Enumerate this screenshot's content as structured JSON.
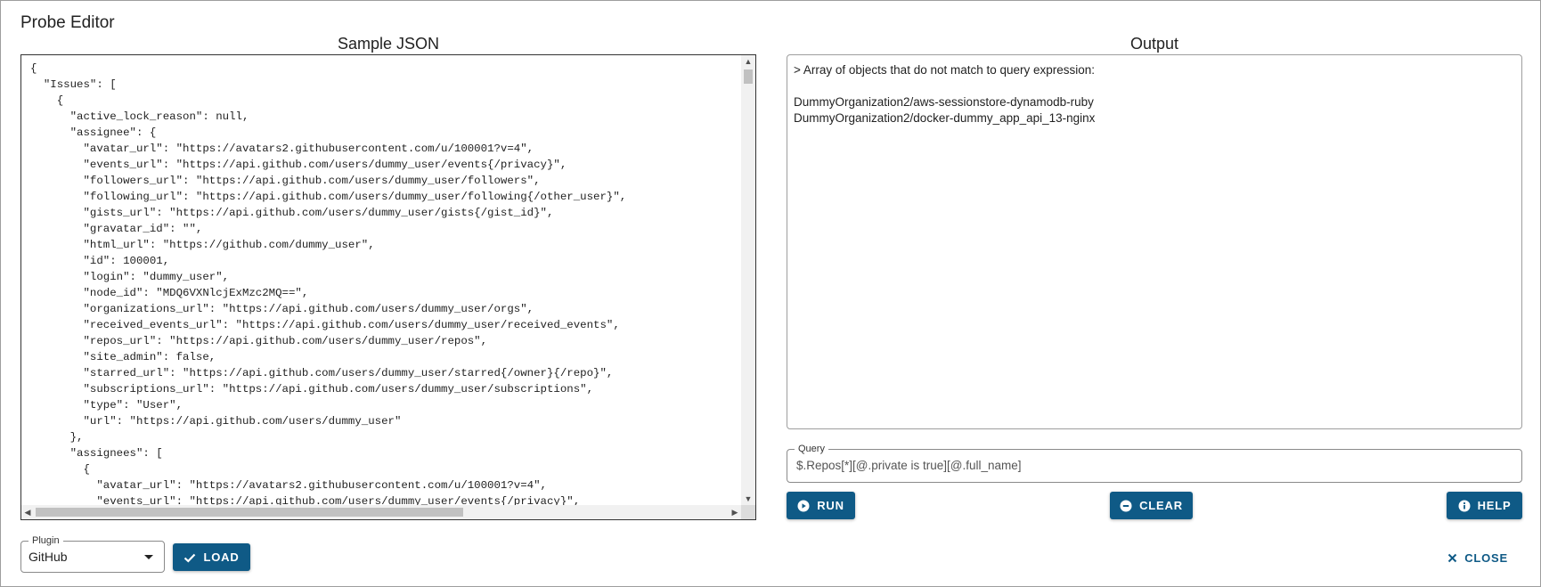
{
  "dialog": {
    "title": "Probe Editor"
  },
  "sample_json": {
    "heading": "Sample JSON",
    "lines": [
      "{",
      "  \"Issues\": [",
      "    {",
      "      \"active_lock_reason\": null,",
      "      \"assignee\": {",
      "        \"avatar_url\": \"https://avatars2.githubusercontent.com/u/100001?v=4\",",
      "        \"events_url\": \"https://api.github.com/users/dummy_user/events{/privacy}\",",
      "        \"followers_url\": \"https://api.github.com/users/dummy_user/followers\",",
      "        \"following_url\": \"https://api.github.com/users/dummy_user/following{/other_user}\",",
      "        \"gists_url\": \"https://api.github.com/users/dummy_user/gists{/gist_id}\",",
      "        \"gravatar_id\": \"\",",
      "        \"html_url\": \"https://github.com/dummy_user\",",
      "        \"id\": 100001,",
      "        \"login\": \"dummy_user\",",
      "        \"node_id\": \"MDQ6VXNlcjExMzc2MQ==\",",
      "        \"organizations_url\": \"https://api.github.com/users/dummy_user/orgs\",",
      "        \"received_events_url\": \"https://api.github.com/users/dummy_user/received_events\",",
      "        \"repos_url\": \"https://api.github.com/users/dummy_user/repos\",",
      "        \"site_admin\": false,",
      "        \"starred_url\": \"https://api.github.com/users/dummy_user/starred{/owner}{/repo}\",",
      "        \"subscriptions_url\": \"https://api.github.com/users/dummy_user/subscriptions\",",
      "        \"type\": \"User\",",
      "        \"url\": \"https://api.github.com/users/dummy_user\"",
      "      },",
      "      \"assignees\": [",
      "        {",
      "          \"avatar_url\": \"https://avatars2.githubusercontent.com/u/100001?v=4\",",
      "          \"events_url\": \"https://api.github.com/users/dummy_user/events{/privacy}\","
    ]
  },
  "output": {
    "heading": "Output",
    "lines": [
      "> Array of objects that do not match to query expression:",
      "",
      "DummyOrganization2/aws-sessionstore-dynamodb-ruby",
      "DummyOrganization2/docker-dummy_app_api_13-nginx"
    ]
  },
  "query": {
    "label": "Query",
    "value": "$.Repos[*][@.private is true][@.full_name]"
  },
  "buttons": {
    "run": {
      "label": "RUN",
      "icon": "play-circle-icon"
    },
    "clear": {
      "label": "CLEAR",
      "icon": "minus-circle-icon"
    },
    "help": {
      "label": "HELP",
      "icon": "info-circle-icon"
    },
    "load": {
      "label": "LOAD",
      "icon": "check-icon"
    },
    "close": {
      "label": "CLOSE",
      "icon": "close-icon"
    }
  },
  "plugin": {
    "label": "Plugin",
    "value": "GitHub"
  },
  "colors": {
    "primary": "#0f5a86",
    "border": "#9e9e9e"
  }
}
